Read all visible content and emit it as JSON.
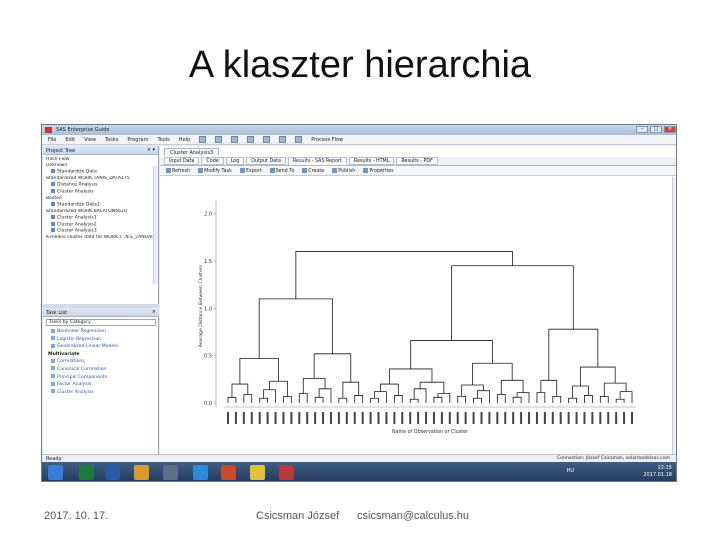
{
  "slide": {
    "title": "A klaszter hierarchia",
    "footer_date": "2017. 10. 17.",
    "footer_author": "Csicsman József",
    "footer_email": "csicsman@calculus.hu"
  },
  "window": {
    "title": "SAS Enterprise Guide",
    "menu": [
      "File",
      "Edit",
      "View",
      "Tasks",
      "Program",
      "Tools",
      "Help"
    ],
    "process_flow": "Process Flow"
  },
  "project_tree": {
    "header": "Project Tree",
    "items": [
      {
        "label": "Hash Flow",
        "indent": false
      },
      {
        "label": "Unknown",
        "indent": false
      },
      {
        "label": "Standardize Data",
        "indent": true
      },
      {
        "label": "Standardized WORK.TANIS_DATA175",
        "indent": false
      },
      {
        "label": "Distance Analysis",
        "indent": true
      },
      {
        "label": "Cluster Analysis",
        "indent": true
      },
      {
        "label": "Boston",
        "indent": false
      },
      {
        "label": "Standardize Data1",
        "indent": true
      },
      {
        "label": "Standardized WORK.BALATON6620",
        "indent": false
      },
      {
        "label": "Cluster Analysis1",
        "indent": true
      },
      {
        "label": "Cluster Analysis2",
        "indent": true
      },
      {
        "label": "Cluster Analysis3",
        "indent": true
      },
      {
        "label": "K-means cluster data for WORK.I...N.E_LANUAR",
        "indent": false
      }
    ]
  },
  "task_list": {
    "header": "Task List",
    "filter": "Tasks by Category",
    "items": [
      {
        "label": "Nonlinear Regression",
        "group": false
      },
      {
        "label": "Logistic Regression",
        "group": false
      },
      {
        "label": "Generalized Linear Models",
        "group": false
      },
      {
        "label": "Multivariate",
        "group": true
      },
      {
        "label": "Correlations",
        "group": false
      },
      {
        "label": "Canonical Correlation",
        "group": false
      },
      {
        "label": "Principal Components",
        "group": false
      },
      {
        "label": "Factor Analysis",
        "group": false
      },
      {
        "label": "Cluster Analysis",
        "group": false
      }
    ]
  },
  "main": {
    "doc_tab": "Cluster Analysis3",
    "tabs": [
      "Input Data",
      "Code",
      "Log",
      "Output Data",
      "Results - SAS Report",
      "Results - HTML",
      "Results - PDF"
    ],
    "active_tab": 4,
    "actions": [
      "Refresh",
      "Modify Task",
      "Export",
      "Send To",
      "Create",
      "Publish",
      "Properties"
    ]
  },
  "status": {
    "left": "Ready",
    "right": "Connection: József Csicsman, solarmodelsas.com"
  },
  "taskbar": {
    "lang": "HU",
    "time": "22:15",
    "date": "2017.01.18"
  },
  "chart_data": {
    "type": "dendrogram",
    "ylabel": "Average Distance Between Clusters",
    "xlabel": "Name of Observation or Cluster",
    "y_ticks": [
      "0.0",
      "0.5",
      "1.0",
      "1.5",
      "2.0"
    ],
    "ylim": [
      0,
      2.05
    ],
    "leaf_count": 52,
    "merges": [
      {
        "a": 0,
        "b": 1,
        "h": 0.05
      },
      {
        "a": 52,
        "b": 2,
        "h": 0.12
      },
      {
        "a": 3,
        "b": 4,
        "h": 0.08
      },
      {
        "a": 5,
        "b": 6,
        "h": 0.04
      },
      {
        "a": 55,
        "b": 7,
        "h": 0.15
      },
      {
        "a": 8,
        "b": 9,
        "h": 0.06
      },
      {
        "a": 57,
        "b": 10,
        "h": 0.1
      },
      {
        "a": 11,
        "b": 12,
        "h": 0.07
      },
      {
        "a": 13,
        "b": 14,
        "h": 0.05
      },
      {
        "a": 60,
        "b": 15,
        "h": 0.13
      },
      {
        "a": 16,
        "b": 17,
        "h": 0.09
      },
      {
        "a": 18,
        "b": 19,
        "h": 0.06
      },
      {
        "a": 63,
        "b": 20,
        "h": 0.11
      },
      {
        "a": 21,
        "b": 22,
        "h": 0.05
      },
      {
        "a": 23,
        "b": 24,
        "h": 0.08
      },
      {
        "a": 25,
        "b": 26,
        "h": 0.07
      },
      {
        "a": 27,
        "b": 28,
        "h": 0.04
      },
      {
        "a": 68,
        "b": 29,
        "h": 0.12
      },
      {
        "a": 30,
        "b": 31,
        "h": 0.06
      },
      {
        "a": 32,
        "b": 33,
        "h": 0.09
      },
      {
        "a": 34,
        "b": 35,
        "h": 0.05
      },
      {
        "a": 72,
        "b": 36,
        "h": 0.14
      },
      {
        "a": 37,
        "b": 38,
        "h": 0.07
      },
      {
        "a": 39,
        "b": 40,
        "h": 0.1
      },
      {
        "a": 41,
        "b": 42,
        "h": 0.06
      },
      {
        "a": 76,
        "b": 43,
        "h": 0.15
      },
      {
        "a": 44,
        "b": 45,
        "h": 0.05
      },
      {
        "a": 46,
        "b": 47,
        "h": 0.08
      },
      {
        "a": 48,
        "b": 49,
        "h": 0.11
      },
      {
        "a": 50,
        "b": 51,
        "h": 0.07
      },
      {
        "a": 53,
        "b": 54,
        "h": 0.2
      },
      {
        "a": 56,
        "b": 58,
        "h": 0.22
      },
      {
        "a": 59,
        "b": 61,
        "h": 0.19
      },
      {
        "a": 62,
        "b": 64,
        "h": 0.24
      },
      {
        "a": 65,
        "b": 66,
        "h": 0.18
      },
      {
        "a": 67,
        "b": 69,
        "h": 0.21
      },
      {
        "a": 70,
        "b": 71,
        "h": 0.2
      },
      {
        "a": 73,
        "b": 74,
        "h": 0.23
      },
      {
        "a": 75,
        "b": 77,
        "h": 0.26
      },
      {
        "a": 78,
        "b": 79,
        "h": 0.22
      },
      {
        "a": 80,
        "b": 81,
        "h": 0.24
      },
      {
        "a": 82,
        "b": 83,
        "h": 0.36
      },
      {
        "a": 84,
        "b": 85,
        "h": 0.42
      },
      {
        "a": 86,
        "b": 87,
        "h": 0.38
      },
      {
        "a": 88,
        "b": 89,
        "h": 0.47
      },
      {
        "a": 90,
        "b": 91,
        "h": 0.52
      },
      {
        "a": 93,
        "b": 94,
        "h": 0.66
      },
      {
        "a": 92,
        "b": 95,
        "h": 0.78
      },
      {
        "a": 96,
        "b": 97,
        "h": 1.1
      },
      {
        "a": 98,
        "b": 99,
        "h": 1.45
      },
      {
        "a": 100,
        "b": 101,
        "h": 1.6
      }
    ]
  }
}
